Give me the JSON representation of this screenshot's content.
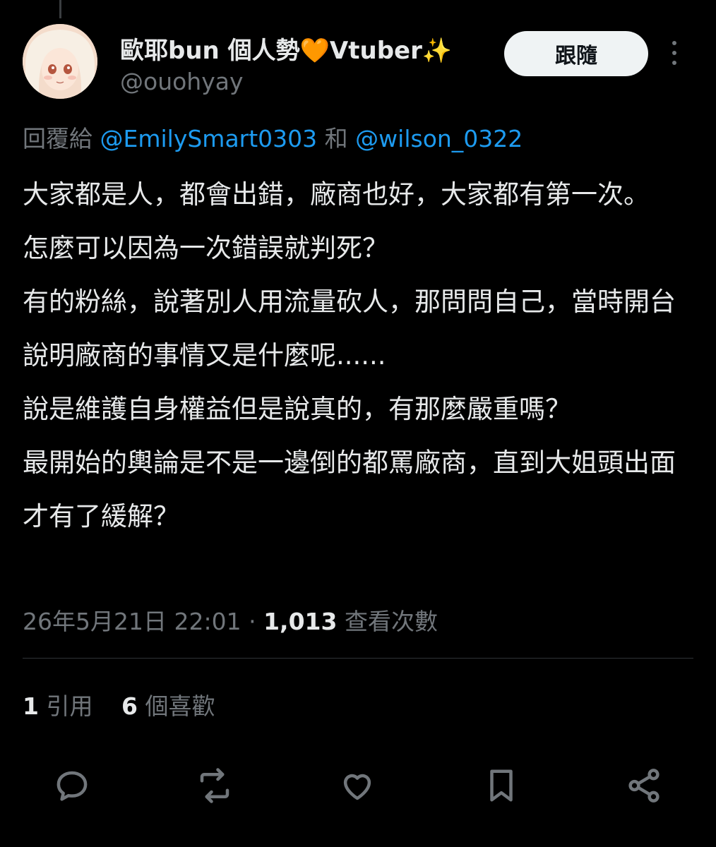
{
  "author": {
    "display_name": "歐耶bun 個人勢🧡Vtuber✨",
    "handle": "@ouohyay"
  },
  "follow_button_label": "跟隨",
  "reply": {
    "prefix": "回覆給",
    "mention1": "@EmilySmart0303",
    "joiner": "和",
    "mention2": "@wilson_0322"
  },
  "tweet_lines": [
    "大家都是人，都會出錯，廠商也好，大家都有第一次。",
    "怎麼可以因為一次錯誤就判死？",
    "有的粉絲，說著別人用流量砍人，那問問自己，當時開台說明廠商的事情又是什麼呢......",
    "說是維護自身權益但是說真的，有那麼嚴重嗎？",
    "最開始的輿論是不是一邊倒的都罵廠商，直到大姐頭出面才有了緩解？"
  ],
  "meta": {
    "timestamp": "26年5月21日 22:01",
    "separator": "·",
    "view_count": "1,013",
    "view_label": "查看次數"
  },
  "stats": {
    "quotes_count": "1",
    "quotes_label": "引用",
    "likes_count": "6",
    "likes_label": "個喜歡"
  },
  "actions": [
    "reply-icon",
    "retweet-icon",
    "like-icon",
    "bookmark-icon",
    "share-icon"
  ],
  "colors": {
    "background": "#000000",
    "text": "#e7e9ea",
    "muted": "#71767b",
    "link": "#1d9bf0",
    "button_bg": "#eff3f4"
  }
}
